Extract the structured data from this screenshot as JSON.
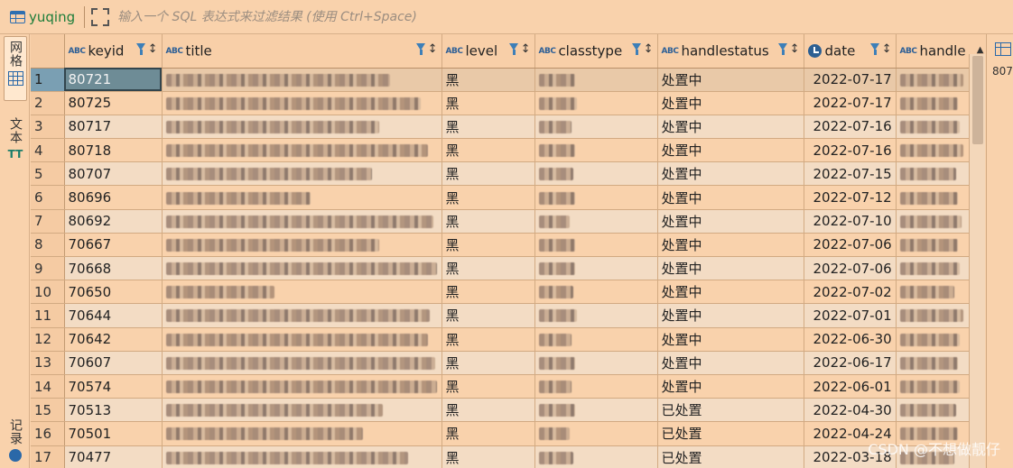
{
  "toolbar": {
    "table_name": "yuqing",
    "filter_placeholder": "输入一个 SQL 表达式来过滤结果 (使用 Ctrl+Space)"
  },
  "left_tabs": {
    "grid": "网格",
    "text": "文本",
    "record": "记录"
  },
  "columns": [
    {
      "key": "keyid",
      "label": "keyid",
      "type": "ABC"
    },
    {
      "key": "title",
      "label": "title",
      "type": "ABC"
    },
    {
      "key": "level",
      "label": "level",
      "type": "ABC"
    },
    {
      "key": "classtype",
      "label": "classtype",
      "type": "ABC"
    },
    {
      "key": "handlestatus",
      "label": "handlestatus",
      "type": "ABC"
    },
    {
      "key": "date",
      "label": "date",
      "type": "clock"
    },
    {
      "key": "handle",
      "label": "handle",
      "type": "ABC"
    }
  ],
  "rows": [
    {
      "n": "1",
      "keyid": "80721",
      "level": "黑",
      "handlestatus": "处置中",
      "date": "2022-07-17"
    },
    {
      "n": "2",
      "keyid": "80725",
      "level": "黑",
      "handlestatus": "处置中",
      "date": "2022-07-17"
    },
    {
      "n": "3",
      "keyid": "80717",
      "level": "黑",
      "handlestatus": "处置中",
      "date": "2022-07-16"
    },
    {
      "n": "4",
      "keyid": "80718",
      "level": "黑",
      "handlestatus": "处置中",
      "date": "2022-07-16"
    },
    {
      "n": "5",
      "keyid": "80707",
      "level": "黑",
      "handlestatus": "处置中",
      "date": "2022-07-15"
    },
    {
      "n": "6",
      "keyid": "80696",
      "level": "黑",
      "handlestatus": "处置中",
      "date": "2022-07-12"
    },
    {
      "n": "7",
      "keyid": "80692",
      "level": "黑",
      "handlestatus": "处置中",
      "date": "2022-07-10"
    },
    {
      "n": "8",
      "keyid": "70667",
      "level": "黑",
      "handlestatus": "处置中",
      "date": "2022-07-06"
    },
    {
      "n": "9",
      "keyid": "70668",
      "level": "黑",
      "handlestatus": "处置中",
      "date": "2022-07-06"
    },
    {
      "n": "10",
      "keyid": "70650",
      "level": "黑",
      "handlestatus": "处置中",
      "date": "2022-07-02"
    },
    {
      "n": "11",
      "keyid": "70644",
      "level": "黑",
      "handlestatus": "处置中",
      "date": "2022-07-01"
    },
    {
      "n": "12",
      "keyid": "70642",
      "level": "黑",
      "handlestatus": "处置中",
      "date": "2022-06-30"
    },
    {
      "n": "13",
      "keyid": "70607",
      "level": "黑",
      "handlestatus": "处置中",
      "date": "2022-06-17"
    },
    {
      "n": "14",
      "keyid": "70574",
      "level": "黑",
      "handlestatus": "处置中",
      "date": "2022-06-01"
    },
    {
      "n": "15",
      "keyid": "70513",
      "level": "黑",
      "handlestatus": "已处置",
      "date": "2022-04-30"
    },
    {
      "n": "16",
      "keyid": "70501",
      "level": "黑",
      "handlestatus": "已处置",
      "date": "2022-04-24"
    },
    {
      "n": "17",
      "keyid": "70477",
      "level": "黑",
      "handlestatus": "已处置",
      "date": "2022-03-18"
    }
  ],
  "right_panel": {
    "value": "807"
  },
  "watermark": "CSDN @不想做靓仔",
  "colors": {
    "background": "#f9d2ac",
    "selected_cell": "#6e8c96",
    "accent": "#2e6fb0"
  }
}
